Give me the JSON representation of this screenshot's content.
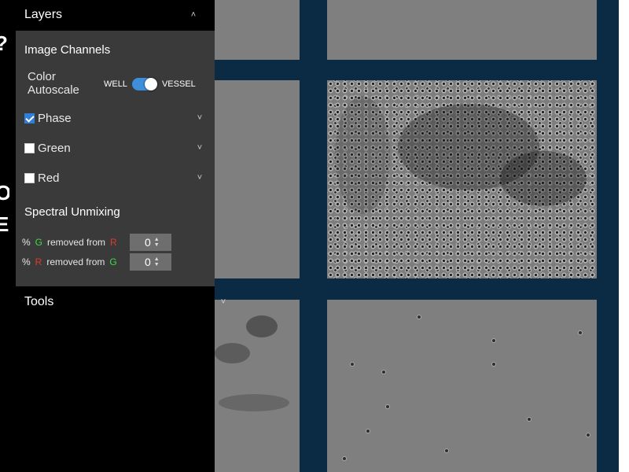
{
  "sidebar": {
    "layers": {
      "title": "Layers",
      "collapse_icon": "double-chevron-up-icon"
    },
    "image_channels": {
      "title": "Image Channels",
      "color_autoscale_label_line1": "Color",
      "color_autoscale_label_line2": "Autoscale",
      "toggle_left": "WELL",
      "toggle_right": "VESSEL",
      "toggle_state": "VESSEL"
    },
    "channels": [
      {
        "label": "Phase",
        "checked": true
      },
      {
        "label": "Green",
        "checked": false
      },
      {
        "label": "Red",
        "checked": false
      }
    ],
    "spectral_unmixing": {
      "title": "Spectral Unmixing",
      "rows": [
        {
          "pct": "%",
          "from": "G",
          "removed": "removed from",
          "to": "R",
          "value": "0"
        },
        {
          "pct": "%",
          "from": "R",
          "removed": "removed from",
          "to": "G",
          "value": "0"
        }
      ]
    },
    "tools": {
      "title": "Tools",
      "expand_icon": "double-chevron-down-icon"
    }
  },
  "colors": {
    "toggle_accent": "#3d8fd9",
    "green": "#3fdc3f",
    "red": "#e03a2a",
    "viewer_background": "#0b2b45"
  }
}
